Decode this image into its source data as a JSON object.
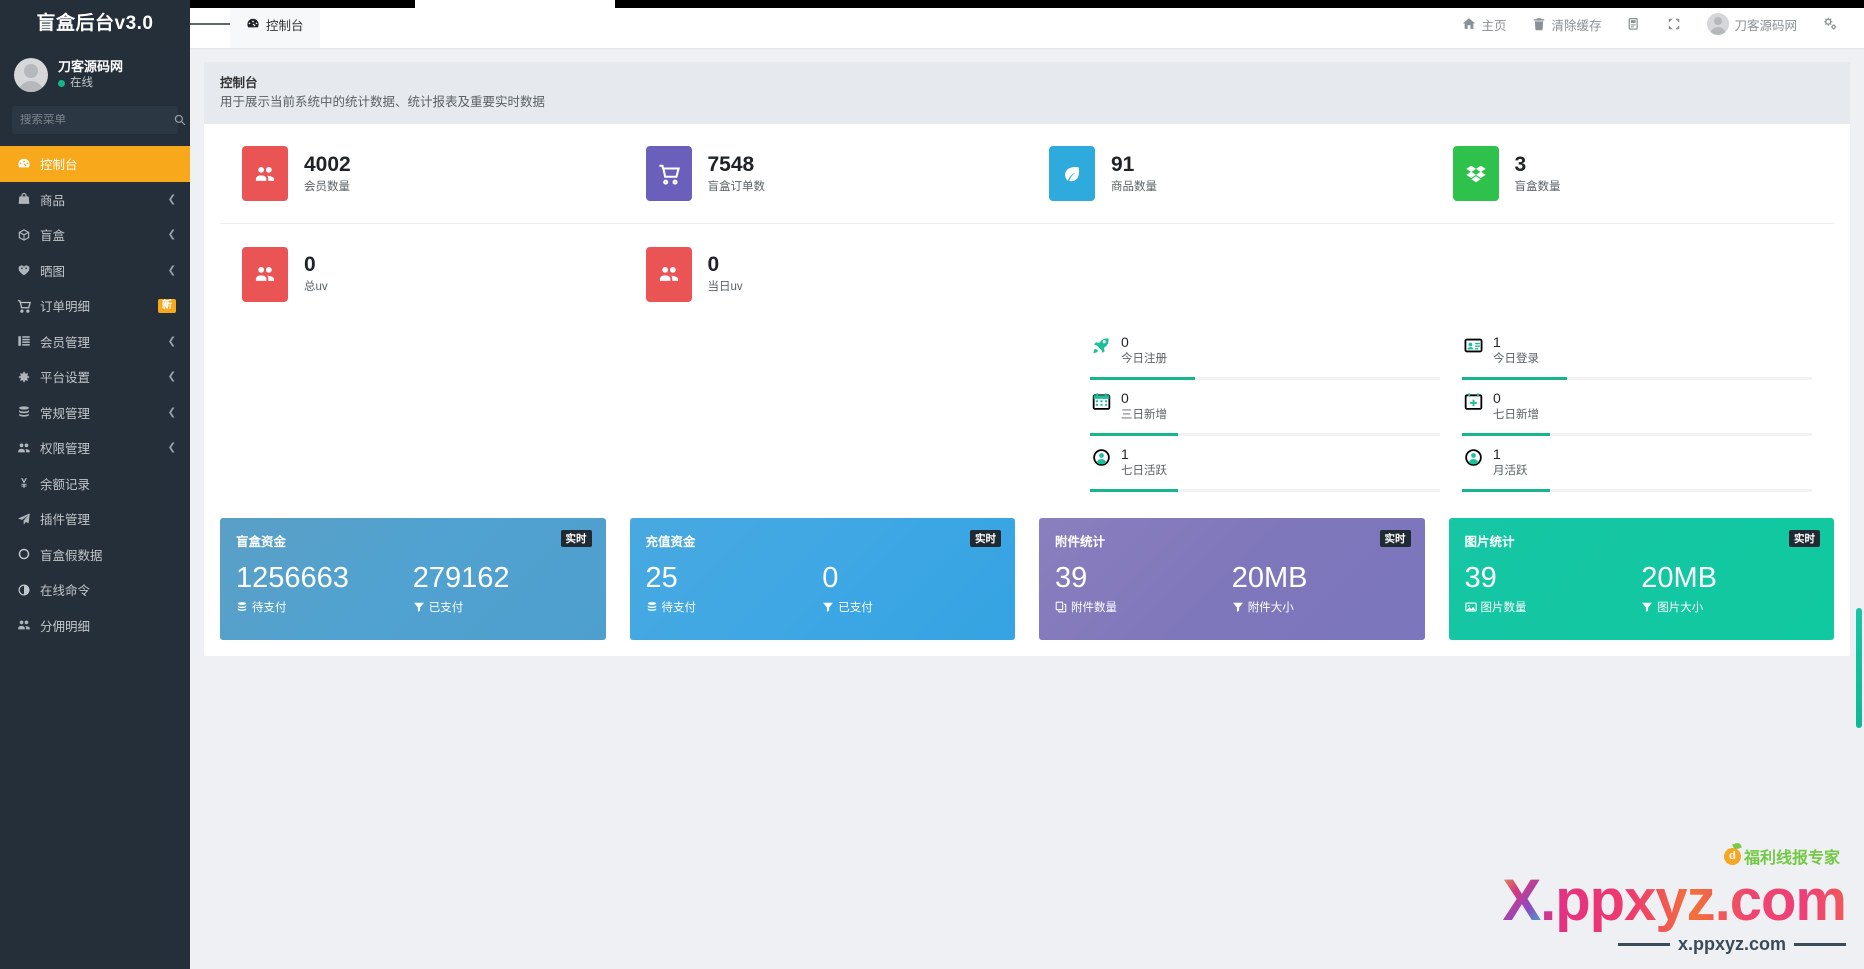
{
  "sidebar": {
    "brand": "盲盒后台v3.0",
    "user": {
      "name": "刀客源码网",
      "status": "在线"
    },
    "search": {
      "placeholder": "搜索菜单",
      "value": ""
    },
    "items": [
      {
        "label": "控制台",
        "icon": "dashboard-icon",
        "active": true,
        "chevron": false,
        "badge": ""
      },
      {
        "label": "商品",
        "icon": "bag-icon",
        "active": false,
        "chevron": true,
        "badge": ""
      },
      {
        "label": "盲盒",
        "icon": "box-icon",
        "active": false,
        "chevron": true,
        "badge": ""
      },
      {
        "label": "晒图",
        "icon": "heart-icon",
        "active": false,
        "chevron": true,
        "badge": ""
      },
      {
        "label": "订单明细",
        "icon": "cart-icon",
        "active": false,
        "chevron": false,
        "badge": "新"
      },
      {
        "label": "会员管理",
        "icon": "list-icon",
        "active": false,
        "chevron": true,
        "badge": ""
      },
      {
        "label": "平台设置",
        "icon": "gear-icon",
        "active": false,
        "chevron": true,
        "badge": ""
      },
      {
        "label": "常规管理",
        "icon": "database-icon",
        "active": false,
        "chevron": true,
        "badge": ""
      },
      {
        "label": "权限管理",
        "icon": "users-icon",
        "active": false,
        "chevron": true,
        "badge": ""
      },
      {
        "label": "余额记录",
        "icon": "yen-icon",
        "active": false,
        "chevron": false,
        "badge": ""
      },
      {
        "label": "插件管理",
        "icon": "plugin-icon",
        "active": false,
        "chevron": false,
        "badge": ""
      },
      {
        "label": "盲盒假数据",
        "icon": "circle-icon",
        "active": false,
        "chevron": false,
        "badge": ""
      },
      {
        "label": "在线命令",
        "icon": "contrast-icon",
        "active": false,
        "chevron": false,
        "badge": ""
      },
      {
        "label": "分佣明细",
        "icon": "users-icon",
        "active": false,
        "chevron": false,
        "badge": ""
      }
    ]
  },
  "header": {
    "menu_icon": "hamburger-icon",
    "tab": {
      "label": "控制台",
      "icon": "dashboard-icon"
    },
    "right": [
      {
        "label": "主页",
        "icon": "home-icon"
      },
      {
        "label": "清除缓存",
        "icon": "trash-icon"
      },
      {
        "label": "",
        "icon": "theme-icon"
      },
      {
        "label": "",
        "icon": "fullscreen-icon"
      },
      {
        "label": "刀客源码网",
        "icon": "avatar-icon"
      },
      {
        "label": "",
        "icon": "settings-gear-icon"
      }
    ]
  },
  "main": {
    "panel": {
      "title": "控制台",
      "desc": "用于展示当前系统中的统计数据、统计报表及重要实时数据"
    },
    "stats": [
      {
        "value": "4002",
        "label": "会员数量",
        "icon": "users-icon",
        "color": "#ea5455"
      },
      {
        "value": "7548",
        "label": "盲盒订单数",
        "icon": "cart-icon",
        "color": "#6a5fbb"
      },
      {
        "value": "91",
        "label": "商品数量",
        "icon": "leaf-icon",
        "color": "#2eaadc"
      },
      {
        "value": "3",
        "label": "盲盒数量",
        "icon": "dropbox-icon",
        "color": "#2ec24c"
      },
      {
        "value": "0",
        "label": "总uv",
        "icon": "users-icon",
        "color": "#ea5455"
      },
      {
        "value": "0",
        "label": "当日uv",
        "icon": "users-icon",
        "color": "#ea5455"
      }
    ],
    "mini_stats": [
      {
        "value": "0",
        "label": "今日注册",
        "icon": "rocket-icon",
        "progress": 30
      },
      {
        "value": "1",
        "label": "今日登录",
        "icon": "idcard-icon",
        "progress": 30
      },
      {
        "value": "0",
        "label": "三日新增",
        "icon": "calendar-icon",
        "progress": 25
      },
      {
        "value": "0",
        "label": "七日新增",
        "icon": "calendar-add-icon",
        "progress": 25
      },
      {
        "value": "1",
        "label": "七日活跃",
        "icon": "user-circle-icon",
        "progress": 25
      },
      {
        "value": "1",
        "label": "月活跃",
        "icon": "user-circle-icon",
        "progress": 25
      }
    ],
    "cards": [
      {
        "title": "盲盒资金",
        "badge": "实时",
        "left": {
          "value": "1256663",
          "label": "待支付",
          "icon": "database-icon"
        },
        "right": {
          "value": "279162",
          "label": "已支付",
          "icon": "filter-icon"
        }
      },
      {
        "title": "充值资金",
        "badge": "实时",
        "left": {
          "value": "25",
          "label": "待支付",
          "icon": "database-icon"
        },
        "right": {
          "value": "0",
          "label": "已支付",
          "icon": "filter-icon"
        }
      },
      {
        "title": "附件统计",
        "badge": "实时",
        "left": {
          "value": "39",
          "label": "附件数量",
          "icon": "copy-icon"
        },
        "right": {
          "value": "20MB",
          "label": "附件大小",
          "icon": "filter-icon"
        }
      },
      {
        "title": "图片统计",
        "badge": "实时",
        "left": {
          "value": "39",
          "label": "图片数量",
          "icon": "image-icon"
        },
        "right": {
          "value": "20MB",
          "label": "图片大小",
          "icon": "filter-icon"
        }
      }
    ]
  },
  "watermark": {
    "x": "X",
    "domain_main": ".ppxyz.com",
    "domain_sub": "x.ppxyz.com",
    "badge": "福利线报专家"
  }
}
